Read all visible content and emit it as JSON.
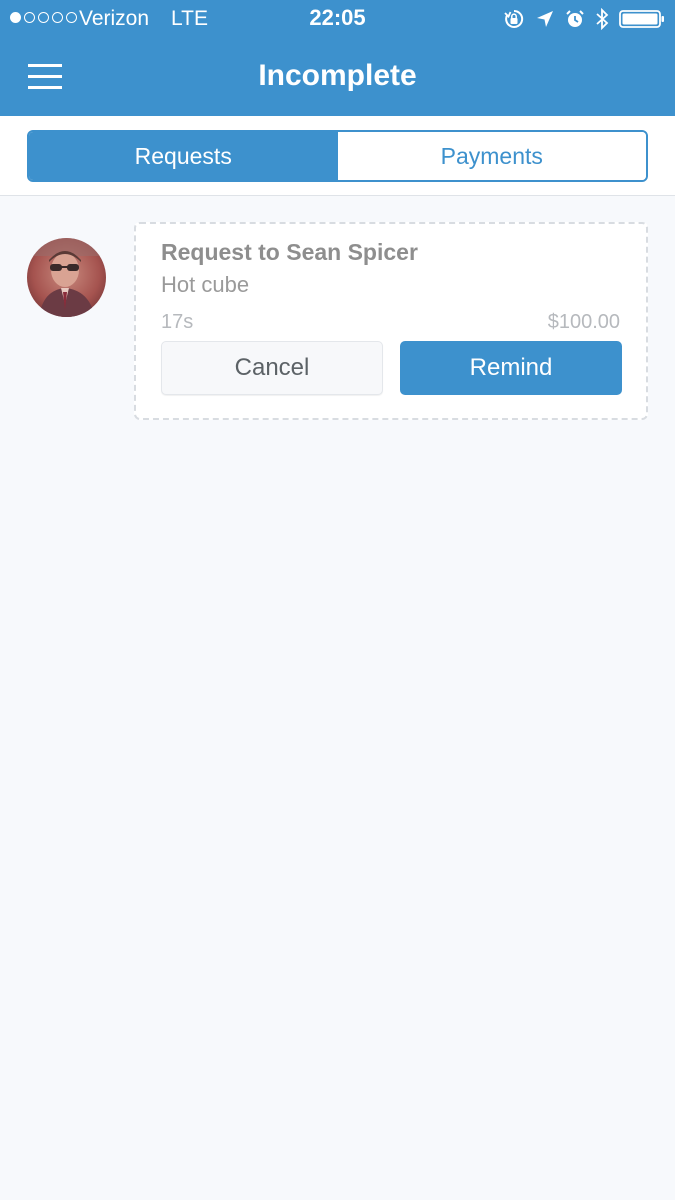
{
  "status_bar": {
    "carrier": "Verizon",
    "network": "LTE",
    "time": "22:05",
    "signal_strength_bars": 1,
    "signal_total_bars": 5,
    "battery_level": 1.0,
    "icons": [
      "orientation-lock-icon",
      "location-arrow-icon",
      "alarm-clock-icon",
      "bluetooth-icon",
      "battery-icon"
    ]
  },
  "nav": {
    "title": "Incomplete",
    "menu_icon": "hamburger-menu-icon"
  },
  "tabs": [
    {
      "label": "Requests",
      "active": true
    },
    {
      "label": "Payments",
      "active": false
    }
  ],
  "requests": [
    {
      "title": "Request to Sean Spicer",
      "note": "Hot cube",
      "time_ago": "17s",
      "amount": "$100.00",
      "cancel_label": "Cancel",
      "remind_label": "Remind"
    }
  ],
  "colors": {
    "brand_blue": "#3d91cd",
    "background": "#f7f9fc",
    "card_border": "#d8dce1",
    "muted_text": "#b6b9bd"
  }
}
